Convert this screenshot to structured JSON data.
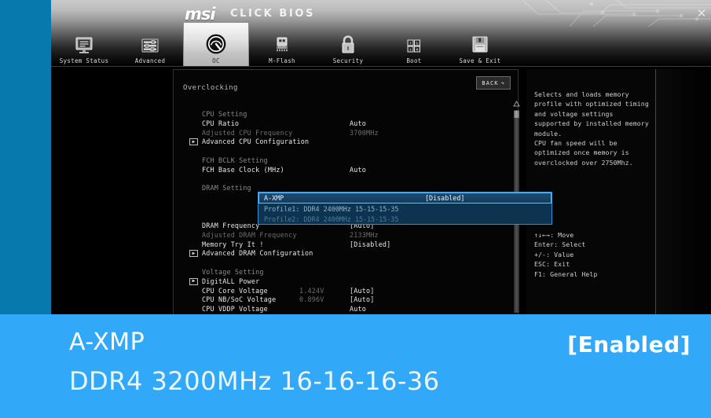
{
  "window": {
    "brand": "msi",
    "brand_sub": "CLICK BIOS",
    "close_icon": "close-icon",
    "close_glyph": "✕"
  },
  "nav": {
    "items": [
      {
        "label": "System Status",
        "icon": "monitor-icon",
        "selected": false
      },
      {
        "label": "Advanced",
        "icon": "sliders-icon",
        "selected": false
      },
      {
        "label": "OC",
        "icon": "gauge-icon",
        "selected": true
      },
      {
        "label": "M-Flash",
        "icon": "usb-drive-icon",
        "selected": false
      },
      {
        "label": "Security",
        "icon": "padlock-icon",
        "selected": false
      },
      {
        "label": "Boot",
        "icon": "boot-grid-icon",
        "selected": false
      },
      {
        "label": "Save & Exit",
        "icon": "floppy-disk-icon",
        "selected": false
      }
    ]
  },
  "panel": {
    "title": "Overclocking",
    "back_label": "BACK",
    "back_icon": "undo-arrow-icon",
    "scroll_up_icon": "scroll-up-arrow-icon",
    "rows": [
      {
        "label": "CPU Setting",
        "value": "",
        "style": "hdr",
        "submenu": false
      },
      {
        "label": "CPU Ratio",
        "value": "Auto",
        "style": "nrm",
        "submenu": false
      },
      {
        "label": "Adjusted CPU Frequency",
        "value": "3700MHz",
        "style": "dim",
        "submenu": false
      },
      {
        "label": "Advanced CPU Configuration",
        "value": "",
        "style": "nrm",
        "submenu": true
      },
      {
        "label": "",
        "value": "",
        "style": "gap",
        "submenu": false
      },
      {
        "label": "FCH BCLK Setting",
        "value": "",
        "style": "hdr",
        "submenu": false
      },
      {
        "label": "FCH Base Clock (MHz)",
        "value": "Auto",
        "style": "nrm",
        "submenu": false
      },
      {
        "label": "",
        "value": "",
        "style": "gap",
        "submenu": false
      },
      {
        "label": "DRAM Setting",
        "value": "",
        "style": "hdr",
        "submenu": false
      }
    ],
    "rows_after": [
      {
        "label": "DRAM Frequency",
        "value": "[Auto]",
        "style": "nrm",
        "submenu": false
      },
      {
        "label": "Adjusted DRAM Frequency",
        "value": "2133MHz",
        "style": "dim",
        "submenu": false
      },
      {
        "label": "Memory Try It !",
        "value": "[Disabled]",
        "style": "nrm",
        "submenu": false
      },
      {
        "label": "Advanced DRAM Configuration",
        "value": "",
        "style": "nrm",
        "submenu": true
      },
      {
        "label": "",
        "value": "",
        "style": "gap",
        "submenu": false
      },
      {
        "label": "Voltage Setting",
        "value": "",
        "style": "hdr",
        "submenu": false
      },
      {
        "label": "DigitALL Power",
        "value": "",
        "style": "nrm",
        "submenu": true
      },
      {
        "label": "CPU Core Voltage",
        "value": "[Auto]",
        "value2": "1.424V",
        "style": "nrm",
        "submenu": false
      },
      {
        "label": "CPU NB/SoC Voltage",
        "value": "[Auto]",
        "value2": "0.896V",
        "style": "nrm",
        "submenu": false
      },
      {
        "label": "CPU VDDP Voltage",
        "value": "Auto",
        "style": "nrm",
        "submenu": false
      }
    ]
  },
  "dropdown": {
    "field_label": "A-XMP",
    "field_value": "[Disabled]",
    "options": [
      "Profile1: DDR4 2400MHz 15-15-15-35",
      "Profile2: DDR4 2400MHz 15-15-15-35"
    ]
  },
  "help": {
    "text": "Selects and loads memory profile with optimized timing and voltage settings supported by installed memory module.\nCPU fan speed will be optimized once memory is overclocked over 2750Mhz.",
    "keys": "↑↓←→: Move\nEnter: Select\n+/-: Value\nESC: Exit\nF1: General Help"
  },
  "banner": {
    "title": "A-XMP",
    "subtitle": "DDR4 3200MHz 16-16-16-36",
    "state": "[Enabled]"
  },
  "colors": {
    "overlay_blue": "#0779ad",
    "banner_blue": "#31a8f8",
    "highlight_border": "#2f8fd4",
    "dropdown_bg": "#0c3350"
  }
}
